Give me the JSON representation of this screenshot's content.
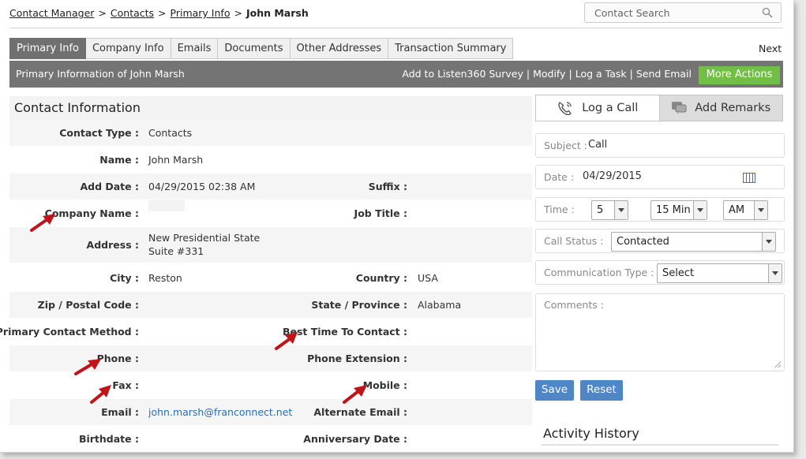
{
  "breadcrumb": {
    "items": [
      "Contact Manager",
      "Contacts",
      "Primary Info"
    ],
    "separator": ">",
    "current": "John Marsh"
  },
  "search": {
    "placeholder": "Contact Search"
  },
  "tabs": [
    {
      "label": "Primary Info",
      "active": true
    },
    {
      "label": "Company Info",
      "active": false
    },
    {
      "label": "Emails",
      "active": false
    },
    {
      "label": "Documents",
      "active": false
    },
    {
      "label": "Other Addresses",
      "active": false
    },
    {
      "label": "Transaction Summary",
      "active": false
    }
  ],
  "next_label": "Next",
  "actionbar": {
    "title": "Primary Information of John Marsh",
    "links": [
      "Add to Listen360 Survey",
      "Modify",
      "Log a Task",
      "Send Email"
    ],
    "more_actions": "More Actions"
  },
  "section_title": "Contact Information",
  "fields": {
    "contact_type": {
      "label": "Contact Type :",
      "value": "Contacts"
    },
    "name": {
      "label": "Name :",
      "value": "John Marsh"
    },
    "add_date": {
      "label": "Add Date :",
      "value": "04/29/2015 02:38 AM"
    },
    "suffix": {
      "label": "Suffix :",
      "value": ""
    },
    "company_name": {
      "label": "Company Name :",
      "value": ""
    },
    "job_title": {
      "label": "Job Title :",
      "value": ""
    },
    "address": {
      "label": "Address :",
      "line1": "New Presidential State",
      "line2": "Suite #331"
    },
    "city": {
      "label": "City :",
      "value": "Reston"
    },
    "country": {
      "label": "Country :",
      "value": "USA"
    },
    "zip": {
      "label": "Zip / Postal Code :",
      "value": ""
    },
    "state": {
      "label": "State / Province :",
      "value": "Alabama"
    },
    "primary_contact_method": {
      "label": "Primary Contact Method :",
      "value": ""
    },
    "best_time": {
      "label": "Best Time To Contact :",
      "value": ""
    },
    "phone": {
      "label": "Phone :",
      "value": ""
    },
    "phone_ext": {
      "label": "Phone Extension :",
      "value": ""
    },
    "fax": {
      "label": "Fax :",
      "value": ""
    },
    "mobile": {
      "label": "Mobile :",
      "value": ""
    },
    "email": {
      "label": "Email :",
      "value": "john.marsh@franconnect.net"
    },
    "alt_email": {
      "label": "Alternate Email :",
      "value": ""
    },
    "birthdate": {
      "label": "Birthdate :",
      "value": ""
    },
    "anniversary": {
      "label": "Anniversary Date :",
      "value": ""
    }
  },
  "call_panel": {
    "tab_log_call": "Log a Call",
    "tab_add_remarks": "Add Remarks",
    "subject_label": "Subject :",
    "subject_value": "Call",
    "date_label": "Date :",
    "date_value": "04/29/2015",
    "time_label": "Time :",
    "time_hour": "5",
    "time_min": "15 Min",
    "time_ampm": "AM",
    "call_status_label": "Call Status :",
    "call_status_value": "Contacted",
    "comm_type_label": "Communication Type :",
    "comm_type_value": "Select",
    "comments_label": "Comments :",
    "save": "Save",
    "reset": "Reset"
  },
  "activity_history": "Activity History",
  "colors": {
    "tab_active": "#707070",
    "action_bar": "#747474",
    "more_actions": "#71bf44",
    "button_blue": "#4e86c6",
    "link_blue": "#2a6fb5",
    "arrow_red": "#c0141b"
  }
}
